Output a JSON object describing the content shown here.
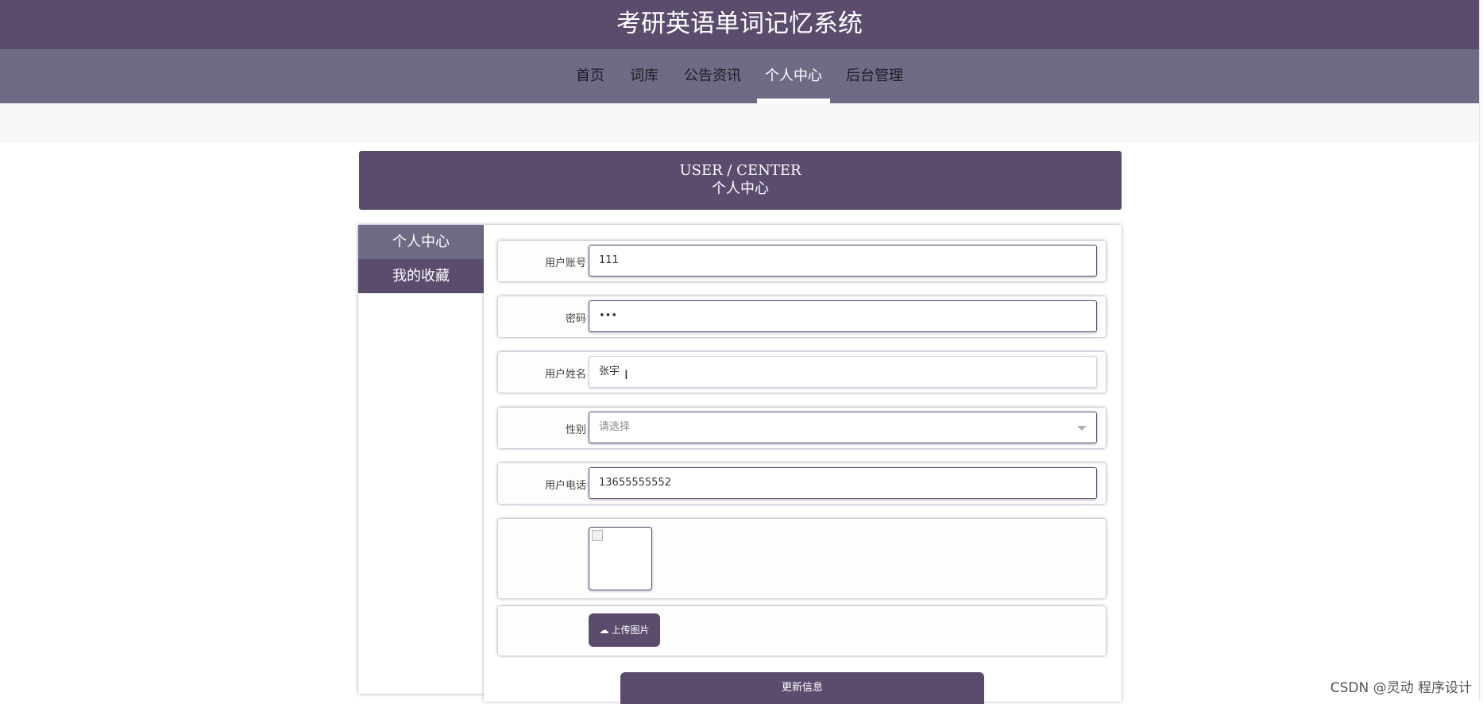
{
  "site": {
    "title": "考研英语单词记忆系统"
  },
  "nav": {
    "items": [
      {
        "label": "首页"
      },
      {
        "label": "词库"
      },
      {
        "label": "公告资讯"
      },
      {
        "label": "个人中心"
      },
      {
        "label": "后台管理"
      }
    ],
    "active_label": "个人中心"
  },
  "banner": {
    "en": "USER / CENTER",
    "cn": "个人中心"
  },
  "sidebar": {
    "items": [
      {
        "label": "个人中心"
      },
      {
        "label": "我的收藏"
      }
    ],
    "active_label": "个人中心"
  },
  "form": {
    "account": {
      "label": "用户账号",
      "value": "111"
    },
    "password": {
      "label": "密码",
      "value": "•••"
    },
    "name": {
      "label": "用户姓名",
      "value": "张宇"
    },
    "gender": {
      "label": "性别",
      "value": "请选择"
    },
    "phone": {
      "label": "用户电话",
      "value": "13655555552"
    },
    "upload_label": "上传图片",
    "submit_label": "更新信息"
  },
  "icons": {
    "upload": "cloud-upload-icon",
    "select_caret": "chevron-down-icon",
    "text_cursor": "text-cursor-icon",
    "broken_image": "broken-image-icon"
  },
  "colors": {
    "header": "#5b4c6e",
    "nav": "#6f6b85",
    "accent": "#5b4c6e"
  },
  "watermark": "CSDN @灵动 程序设计"
}
